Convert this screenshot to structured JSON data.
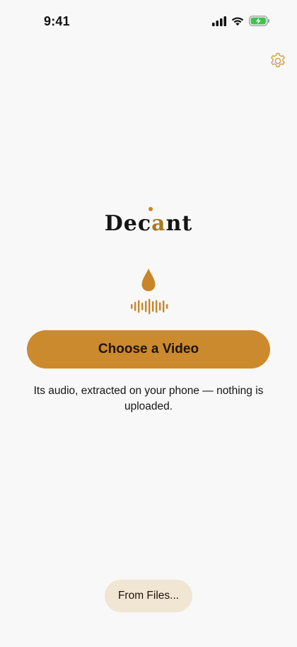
{
  "status_bar": {
    "time": "9:41"
  },
  "brand": {
    "prefix": "Dec",
    "accent_letter": "a",
    "suffix": "nt",
    "accent_color": "#cc8a2e"
  },
  "icons": {
    "settings": "gear-icon",
    "drop": "drop-icon",
    "waveform": "waveform-icon",
    "signal": "cellular-signal-icon",
    "wifi": "wifi-icon",
    "battery": "battery-charging-icon"
  },
  "main": {
    "choose_video_label": "Choose a Video",
    "caption": "Its audio, extracted on your phone — nothing is uploaded."
  },
  "footer": {
    "from_files_label": "From Files..."
  }
}
